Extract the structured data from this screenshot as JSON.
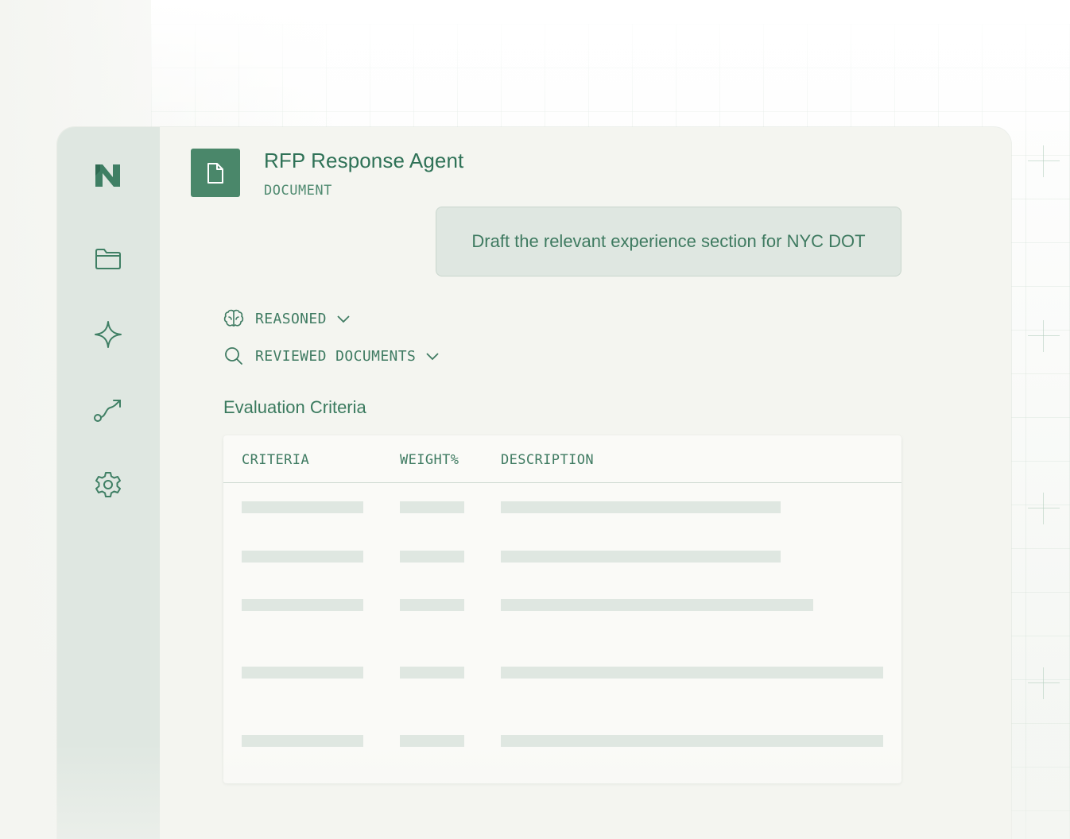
{
  "app": {
    "title": "RFP Response Agent",
    "subtitle": "DOCUMENT"
  },
  "sidebar": {
    "items": [
      {
        "icon": "logo-n-icon"
      },
      {
        "icon": "folder-icon"
      },
      {
        "icon": "sparkle-icon"
      },
      {
        "icon": "workflow-icon"
      },
      {
        "icon": "gear-icon"
      }
    ]
  },
  "prompt": {
    "text": "Draft the relevant experience section for NYC DOT"
  },
  "steps": [
    {
      "label": "REASONED",
      "icon": "brain-icon"
    },
    {
      "label": "REVIEWED DOCUMENTS",
      "icon": "search-icon"
    }
  ],
  "table": {
    "section_title": "Evaluation Criteria",
    "columns": [
      "CRITERIA",
      "WEIGHT%",
      "DESCRIPTION"
    ],
    "rows_loading": 5
  },
  "colors": {
    "accent": "#4a876a",
    "text": "#2f7257",
    "sidebar": "#dfe7e1",
    "placeholder": "#dfe7e1",
    "window_bg": "#f4f5f0"
  }
}
